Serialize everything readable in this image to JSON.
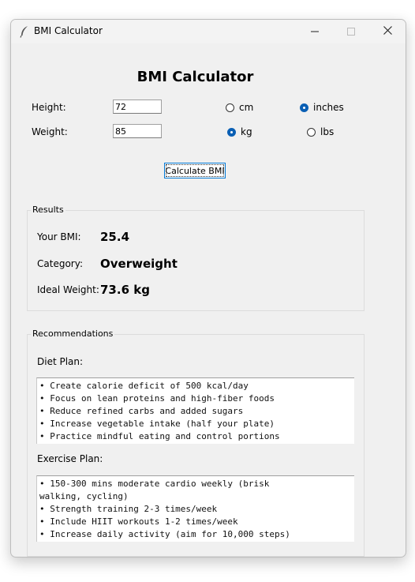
{
  "window": {
    "title": "BMI Calculator",
    "accent": "#0a5fb4"
  },
  "header": {
    "title": "BMI Calculator"
  },
  "form": {
    "height_label": "Height:",
    "height_value": "72",
    "weight_label": "Weight:",
    "weight_value": "85",
    "height_units": [
      {
        "label": "cm",
        "selected": false
      },
      {
        "label": "inches",
        "selected": true
      }
    ],
    "weight_units": [
      {
        "label": "kg",
        "selected": true
      },
      {
        "label": "lbs",
        "selected": false
      }
    ],
    "calculate_label": "Calculate BMI"
  },
  "results": {
    "title": "Results",
    "bmi_label": "Your BMI:",
    "bmi_value": "25.4",
    "category_label": "Category:",
    "category_value": "Overweight",
    "ideal_label": "Ideal Weight:",
    "ideal_value": "73.6 kg"
  },
  "recommendations": {
    "title": "Recommendations",
    "diet_label": "Diet Plan:",
    "diet_text": "• Create calorie deficit of 500 kcal/day\n• Focus on lean proteins and high-fiber foods\n• Reduce refined carbs and added sugars\n• Increase vegetable intake (half your plate)\n• Practice mindful eating and control portions",
    "exercise_label": "Exercise Plan:",
    "exercise_text": "• 150-300 mins moderate cardio weekly (brisk\nwalking, cycling)\n• Strength training 2-3 times/week\n• Include HIIT workouts 1-2 times/week\n• Increase daily activity (aim for 10,000 steps)"
  }
}
